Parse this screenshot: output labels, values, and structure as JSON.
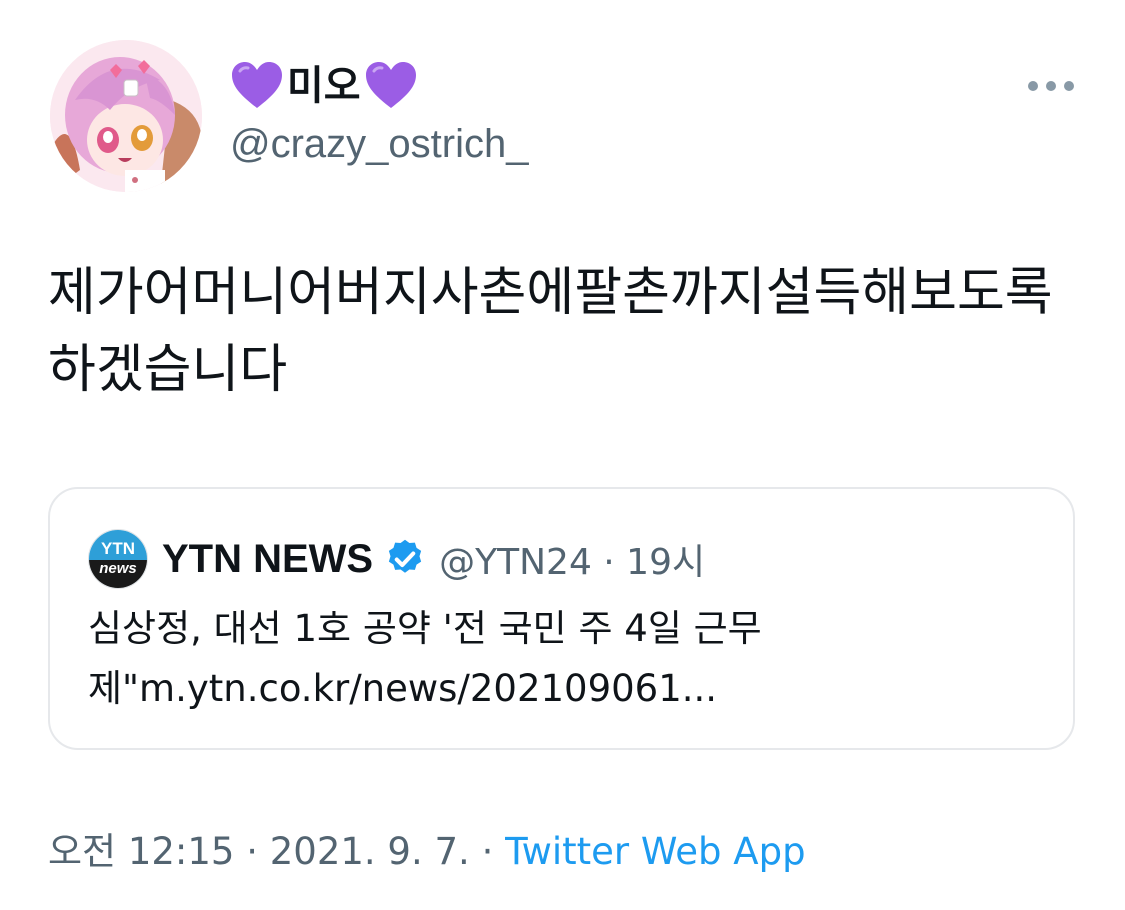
{
  "tweet": {
    "author": {
      "display_name": "미오",
      "handle": "@crazy_ostrich_",
      "name_decoration": "purple-heart-icon"
    },
    "text": "제가어머니어버지사촌에팔촌까지설득해보도록하겠습니다",
    "quoted_tweet": {
      "author_name": "YTN NEWS",
      "logo_top": "YTN",
      "logo_bottom": "news",
      "verified": true,
      "meta": "@YTN24 · 19시",
      "text": "심상정, 대선 1호 공약 '전 국민 주 4일 근무\n제\"m.ytn.co.kr/news/202109061..."
    },
    "footer": {
      "timestamp": "오전 12:15 · 2021. 9. 7. · ",
      "source": "Twitter Web App"
    }
  },
  "colors": {
    "heart": "#9b5de5",
    "verified": "#1d9bf0",
    "link": "#1d9bf0",
    "secondary_text": "#536471"
  }
}
